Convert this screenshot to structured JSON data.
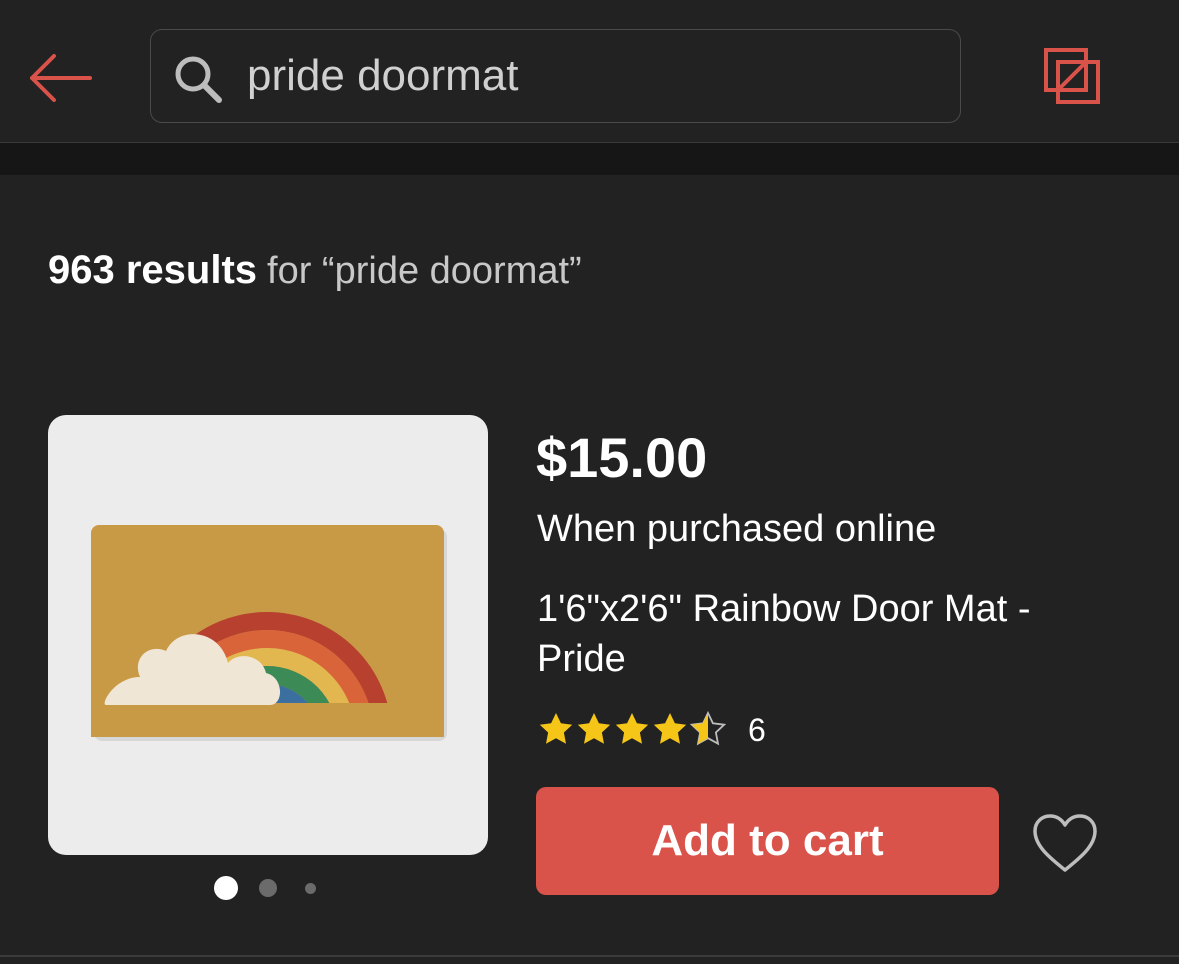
{
  "header": {
    "back_icon": "arrow-left-icon",
    "search": {
      "value": "pride doormat",
      "icon": "search-icon"
    },
    "compare_icon": "compare-icon"
  },
  "results": {
    "count": "963 results",
    "query": "for “pride doormat”"
  },
  "product": {
    "price": "$15.00",
    "price_note": "When purchased online",
    "title": "1'6\"x2'6\" Rainbow Door Mat - Pride",
    "rating": 4.5,
    "rating_max": 5,
    "review_count": "6",
    "add_to_cart": "Add to cart",
    "image_carousel": {
      "total": 3,
      "active": 1
    }
  },
  "colors": {
    "accent": "#d9534a",
    "background": "#222222",
    "star": "#f5c518"
  }
}
